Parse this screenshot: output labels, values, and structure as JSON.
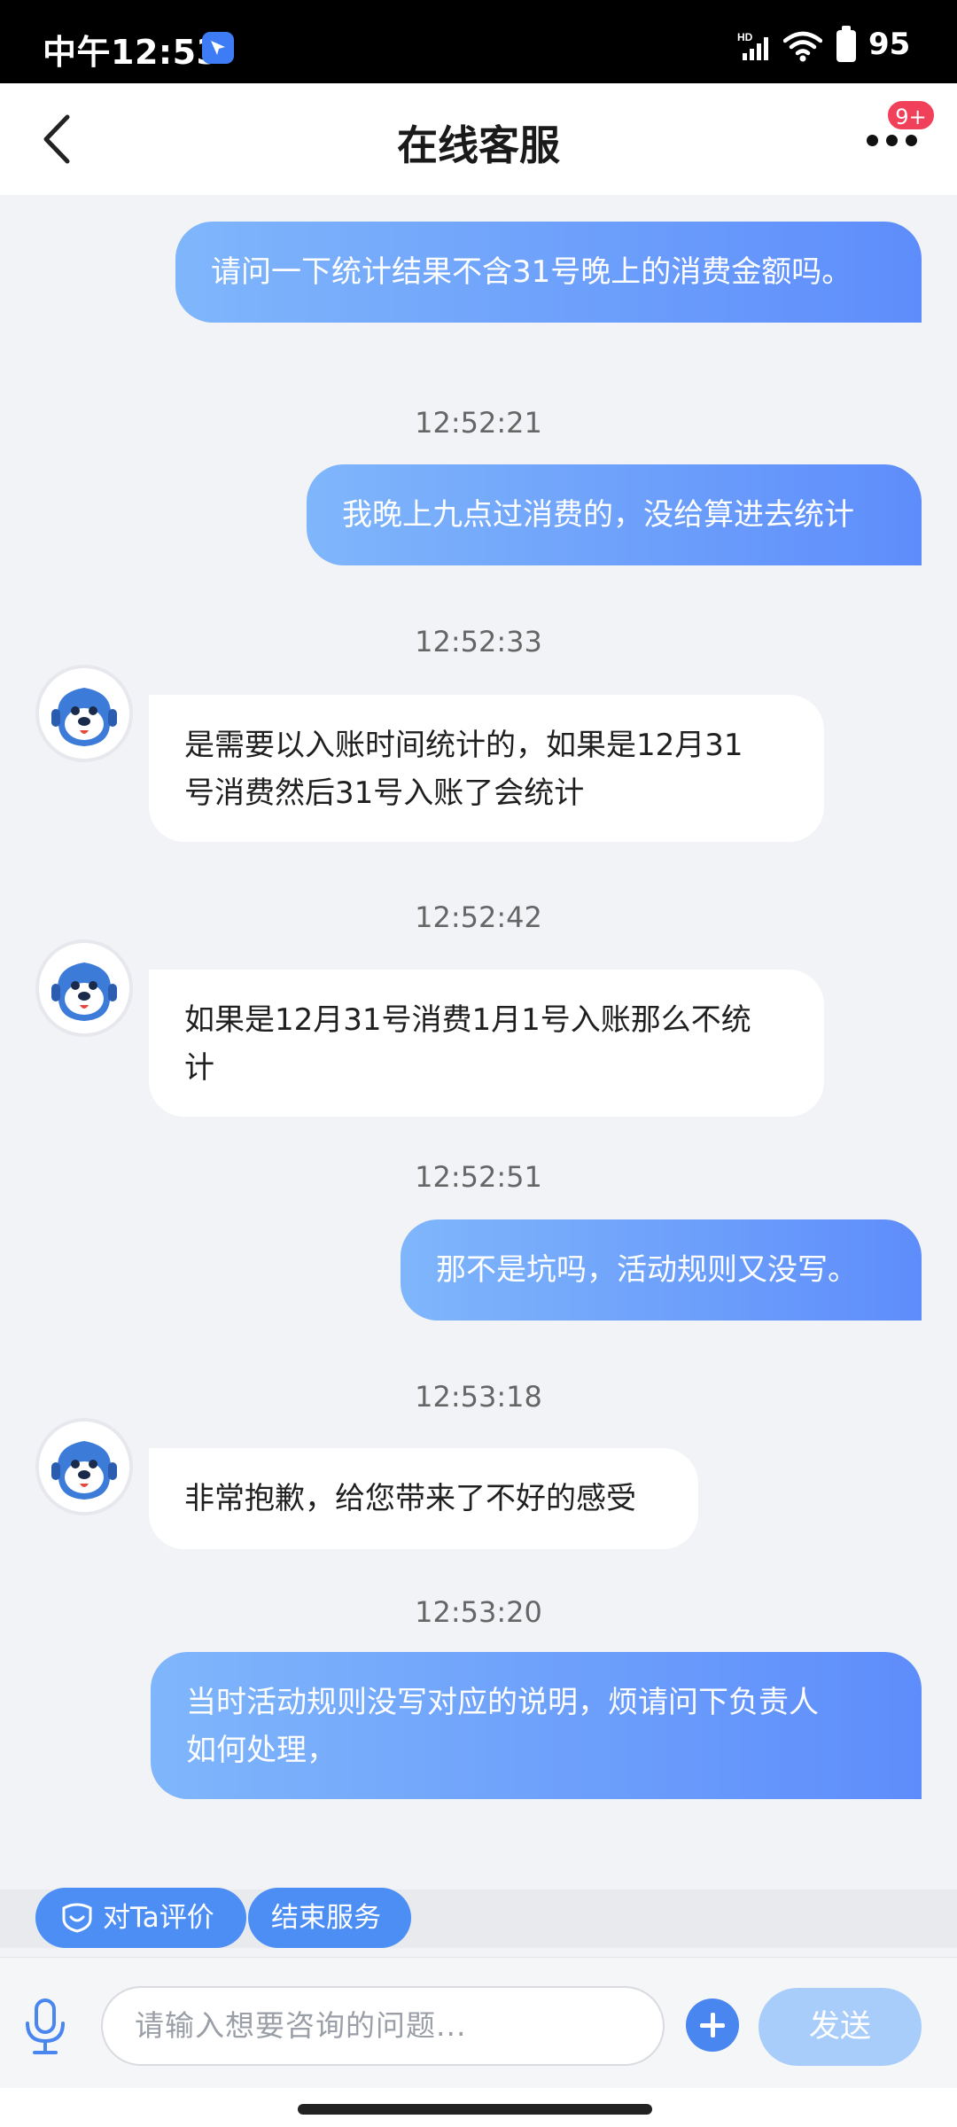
{
  "status_bar": {
    "time": "中午12:53",
    "battery": "95",
    "network": "HD"
  },
  "header": {
    "title": "在线客服",
    "badge": "9+"
  },
  "messages": [
    {
      "side": "out",
      "text": "请问一下统计结果不含31号晚上的消费金额吗。"
    },
    {
      "time": "12:52:21"
    },
    {
      "side": "out",
      "text": "我晚上九点过消费的，没给算进去统计"
    },
    {
      "time": "12:52:33"
    },
    {
      "side": "in",
      "lines": [
        "是需要以入账时间统计的，如果是12月31",
        "号消费然后31号入账了会统计"
      ]
    },
    {
      "time": "12:52:42"
    },
    {
      "side": "in",
      "lines": [
        "如果是12月31号消费1月1号入账那么不统",
        "计"
      ]
    },
    {
      "time": "12:52:51"
    },
    {
      "side": "out",
      "text": "那不是坑吗，活动规则又没写。"
    },
    {
      "time": "12:53:18"
    },
    {
      "side": "in",
      "text": "非常抱歉，给您带来了不好的感受"
    },
    {
      "time": "12:53:20"
    },
    {
      "side": "out",
      "lines": [
        "当时活动规则没写对应的说明，烦请问下负责人",
        "如何处理，"
      ]
    }
  ],
  "actions": {
    "rate_label": "对Ta评价",
    "end_label": "结束服务"
  },
  "input": {
    "placeholder": "请输入想要咨询的问题...",
    "send_label": "发送"
  },
  "colors": {
    "accent": "#4d8ef5",
    "bubble_out_start": "#7fb6fb",
    "bubble_out_end": "#5e8dfb",
    "badge": "#f0405a"
  }
}
